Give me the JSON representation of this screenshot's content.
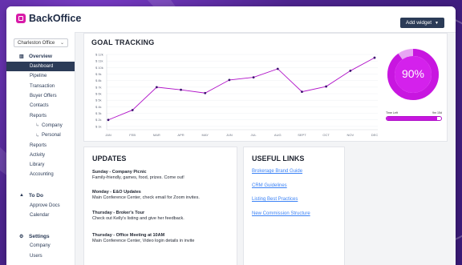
{
  "app": {
    "name": "BackOffice"
  },
  "header": {
    "add_widget_label": "Add widget"
  },
  "sidebar": {
    "office": "Charleston Office",
    "sections": [
      {
        "label": "Overview",
        "icon": "bar-chart-icon",
        "items": [
          {
            "label": "Dashboard",
            "active": true
          },
          {
            "label": "Pipeline"
          },
          {
            "label": "Transaction"
          },
          {
            "label": "Buyer Offers"
          },
          {
            "label": "Contacts"
          },
          {
            "label": "Reports"
          },
          {
            "label": "Company",
            "sub": true
          },
          {
            "label": "Personal",
            "sub": true
          },
          {
            "label": "Reports"
          },
          {
            "label": "Activity"
          },
          {
            "label": "Library"
          },
          {
            "label": "Accounting"
          }
        ]
      },
      {
        "label": "To Do",
        "icon": "bell-icon",
        "items": [
          {
            "label": "Approve Docs"
          },
          {
            "label": "Calendar"
          }
        ]
      },
      {
        "label": "Settings",
        "icon": "gear-icon",
        "items": [
          {
            "label": "Company"
          },
          {
            "label": "Users"
          }
        ]
      }
    ]
  },
  "goal": {
    "title": "GOAL TRACKING",
    "progress_label": "90%",
    "progress": 0.9,
    "time_left_label": "Time Left",
    "time_left_value": "9m 15d",
    "time_left_fraction": 0.92,
    "accent": "#c816e0"
  },
  "chart_data": {
    "type": "line",
    "categories": [
      "JAN",
      "FEB",
      "MAR",
      "APR",
      "MAY",
      "JUN",
      "JUL",
      "AUG",
      "SEPT",
      "OCT",
      "NOV",
      "DEC"
    ],
    "values": [
      2,
      3.5,
      7,
      6.6,
      6.1,
      8.1,
      8.5,
      9.8,
      6.3,
      7.1,
      9.5,
      11.5
    ],
    "y_ticks": [
      "$ 1k",
      "$ 2k",
      "$ 3k",
      "$ 4k",
      "$ 5k",
      "$ 6k",
      "$ 7k",
      "$ 8k",
      "$ 9k",
      "$ 10k",
      "$ 11k",
      "$ 12k"
    ],
    "ylim": [
      0.5,
      12
    ],
    "color": "#b011c8",
    "grid": true
  },
  "updates": {
    "title": "UPDATES",
    "items": [
      {
        "heading": "Sunday - Company Picnic",
        "body": "Family-friendly, games, food, prizes. Come out!"
      },
      {
        "heading": "Monday - E&O Updates",
        "body": "Main Conference Center, check email for Zoom invites."
      },
      {
        "heading": "Thursday - Broker's Tour",
        "body": "Check out Kelly's listing and give her feedback."
      },
      {
        "heading": "Thursday - Office Meeting at 10AM",
        "body": "Main Conference Center, Video login details in invite"
      }
    ]
  },
  "links": {
    "title": "USEFUL LINKS",
    "items": [
      "Brokerage Brand Guide",
      "CRM Guidelines",
      "Listing Best Practices",
      "New Commission Structure"
    ]
  }
}
